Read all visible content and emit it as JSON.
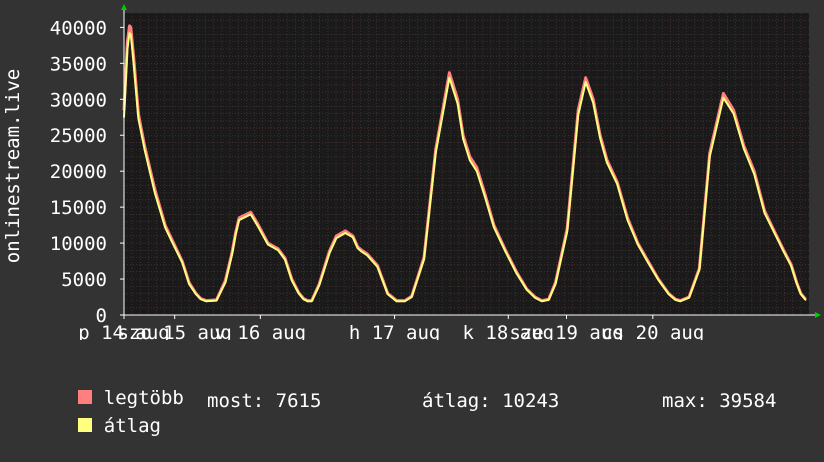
{
  "chart_data": {
    "type": "line",
    "ylabel": "onlinestream.live",
    "ylim": [
      0,
      42000
    ],
    "yticks": [
      0,
      5000,
      10000,
      15000,
      20000,
      25000,
      30000,
      35000,
      40000
    ],
    "xlim": [
      0,
      100
    ],
    "xtick_labels": [
      {
        "x": 0.0,
        "label": "p 14 aug"
      },
      {
        "x": 7.4,
        "label": "szo 15 aug"
      },
      {
        "x": 19.9,
        "label": "v 16 aug"
      },
      {
        "x": 39.5,
        "label": "h 17 aug"
      },
      {
        "x": 56.1,
        "label": "k 18 aug"
      },
      {
        "x": 64.6,
        "label": "sze 19 aug"
      },
      {
        "x": 77.2,
        "label": "cs 20 aug"
      }
    ],
    "grid": true,
    "colors": {
      "background": "#333333",
      "plot_background": "#1a1a1a",
      "grid": "#5a3a3a",
      "legtobb": "#ff7f7f",
      "atlag": "#ffff7f"
    },
    "series": [
      {
        "name": "legtöbb",
        "color": "#ff7f7f",
        "x": [
          0,
          0.5,
          0.8,
          1.0,
          1.4,
          2.1,
          3.0,
          4.5,
          6.0,
          7.0,
          8.5,
          9.5,
          10.5,
          11.2,
          12.0,
          13.5,
          14.8,
          15.8,
          16.3,
          16.8,
          18.5,
          19.5,
          21.0,
          22.5,
          23.5,
          24.5,
          25.5,
          26.2,
          26.8,
          27.4,
          28.5,
          30.0,
          31.0,
          32.3,
          33.4,
          34.1,
          34.7,
          35.5,
          37.0,
          38.5,
          39.8,
          41.0,
          42.0,
          43.8,
          45.5,
          47.5,
          48.7,
          49.5,
          50.5,
          51.5,
          52.7,
          54.0,
          55.7,
          57.3,
          58.8,
          60.0,
          61.0,
          62.0,
          63.0,
          64.7,
          66.3,
          67.4,
          68.5,
          69.5,
          70.5,
          72.0,
          73.5,
          75.0,
          76.5,
          78.0,
          79.5,
          80.5,
          81.2,
          82.5,
          84.0,
          85.5,
          87.5,
          89.0,
          90.5,
          92.0,
          93.5,
          95.0,
          96.3,
          97.4,
          98.2,
          98.8,
          99.5
        ],
        "values": [
          28500,
          38000,
          40200,
          40000,
          36000,
          28000,
          23500,
          17500,
          12500,
          10500,
          7500,
          4500,
          3000,
          2300,
          2000,
          2100,
          4800,
          8800,
          11500,
          13500,
          14300,
          12700,
          10000,
          9200,
          7900,
          5000,
          3100,
          2300,
          2000,
          2000,
          4300,
          8900,
          11000,
          11700,
          11000,
          9500,
          9000,
          8500,
          6900,
          3000,
          2000,
          2000,
          2600,
          8000,
          23000,
          33700,
          30000,
          25000,
          22000,
          20500,
          16800,
          12500,
          9000,
          6000,
          3600,
          2500,
          2000,
          2200,
          4500,
          12000,
          28500,
          33000,
          30000,
          25000,
          21600,
          18500,
          13500,
          10000,
          7500,
          5000,
          3000,
          2200,
          2000,
          2500,
          6500,
          22500,
          30800,
          28500,
          23500,
          20000,
          14500,
          11500,
          9000,
          7000,
          4500,
          3000,
          2200
        ]
      },
      {
        "name": "átlag",
        "color": "#ffff7f",
        "x": [
          0,
          0.5,
          0.8,
          1.0,
          1.4,
          2.1,
          3.0,
          4.5,
          6.0,
          7.0,
          8.5,
          9.5,
          10.5,
          11.2,
          12.0,
          13.5,
          14.8,
          15.8,
          16.3,
          16.8,
          18.5,
          19.5,
          21.0,
          22.5,
          23.5,
          24.5,
          25.5,
          26.2,
          26.8,
          27.4,
          28.5,
          30.0,
          31.0,
          32.3,
          33.4,
          34.1,
          34.7,
          35.5,
          37.0,
          38.5,
          39.8,
          41.0,
          42.0,
          43.8,
          45.5,
          47.5,
          48.7,
          49.5,
          50.5,
          51.5,
          52.7,
          54.0,
          55.7,
          57.3,
          58.8,
          60.0,
          61.0,
          62.0,
          63.0,
          64.7,
          66.3,
          67.4,
          68.5,
          69.5,
          70.5,
          72.0,
          73.5,
          75.0,
          76.5,
          78.0,
          79.5,
          80.5,
          81.2,
          82.5,
          84.0,
          85.5,
          87.5,
          89.0,
          90.5,
          92.0,
          93.5,
          95.0,
          96.3,
          97.4,
          98.2,
          98.8,
          99.5
        ],
        "values": [
          27500,
          37000,
          39200,
          39000,
          35000,
          27300,
          23000,
          17000,
          12200,
          10200,
          7300,
          4300,
          2900,
          2200,
          1900,
          2000,
          4500,
          8500,
          11200,
          13200,
          14000,
          12400,
          9800,
          9000,
          7700,
          4800,
          3000,
          2200,
          1900,
          1900,
          4100,
          8600,
          10700,
          11400,
          10800,
          9300,
          8800,
          8300,
          6700,
          2900,
          1900,
          1900,
          2500,
          7700,
          22500,
          33000,
          29400,
          24500,
          21500,
          20000,
          16400,
          12200,
          8800,
          5800,
          3500,
          2400,
          1900,
          2100,
          4300,
          11600,
          27800,
          32400,
          29500,
          24600,
          21200,
          18200,
          13200,
          9800,
          7300,
          4900,
          2900,
          2100,
          1900,
          2400,
          6300,
          22000,
          30200,
          28000,
          23100,
          19600,
          14200,
          11300,
          8800,
          6800,
          4400,
          2900,
          2100
        ]
      }
    ],
    "legend": [
      {
        "label": "legtöbb",
        "color": "#ff7f7f"
      },
      {
        "label": "átlag",
        "color": "#ffff7f"
      }
    ],
    "stats": {
      "most": "most: 7615",
      "atlag": "átlag: 10243",
      "max": "max: 39584"
    }
  }
}
